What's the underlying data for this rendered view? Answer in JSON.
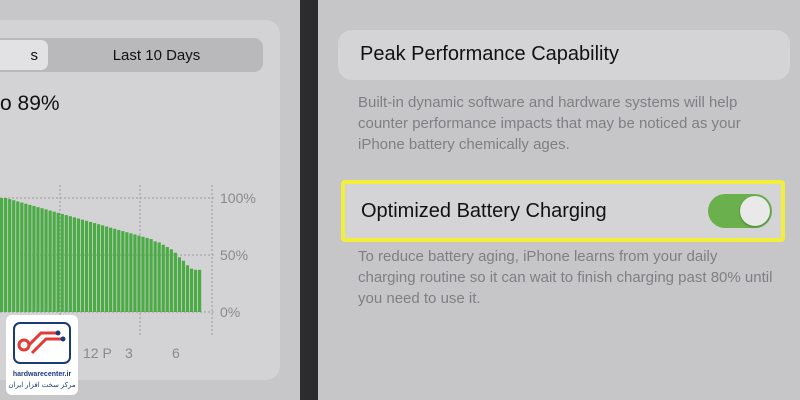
{
  "battery": {
    "segment": {
      "active_label": "s",
      "tab_label": "Last 10 Days"
    },
    "percent_text": "o 89%",
    "colors": {
      "bar": "#4bab45",
      "grid": "#9b9b9f"
    }
  },
  "chart_data": {
    "type": "bar",
    "title": "",
    "xlabel": "",
    "ylabel": "",
    "ylim": [
      0,
      100
    ],
    "y_ticks": [
      "100%",
      "50%",
      "0%"
    ],
    "x_ticks": [
      "12 P",
      "3",
      "6"
    ],
    "values": [
      100,
      100,
      99,
      98,
      97,
      96,
      95,
      94,
      93,
      92,
      91,
      90,
      89,
      88,
      87,
      86,
      85,
      84,
      83,
      82,
      81,
      80,
      79,
      78,
      77,
      76,
      75,
      74,
      73,
      72,
      71,
      70,
      69,
      68,
      67,
      66,
      65,
      64,
      62,
      61,
      59,
      57,
      55,
      52,
      48,
      45,
      41,
      38,
      37,
      37
    ]
  },
  "logo": {
    "name": "hardwarecenter.ir",
    "subtitle": "مرکز سخت افزار ایران"
  },
  "settings": {
    "peak_title": "Peak Performance Capability",
    "peak_description": "Built-in dynamic software and hardware systems will help counter performance impacts that may be noticed as your iPhone battery chemically ages.",
    "optimized_label": "Optimized Battery Charging",
    "optimized_enabled": true,
    "optimized_description": "To reduce battery aging, iPhone learns from your daily charging routine so it can wait to finish charging past 80% until you need to use it.",
    "highlight_color": "#f2ef3c",
    "toggle_on_color": "#6ab04c"
  }
}
